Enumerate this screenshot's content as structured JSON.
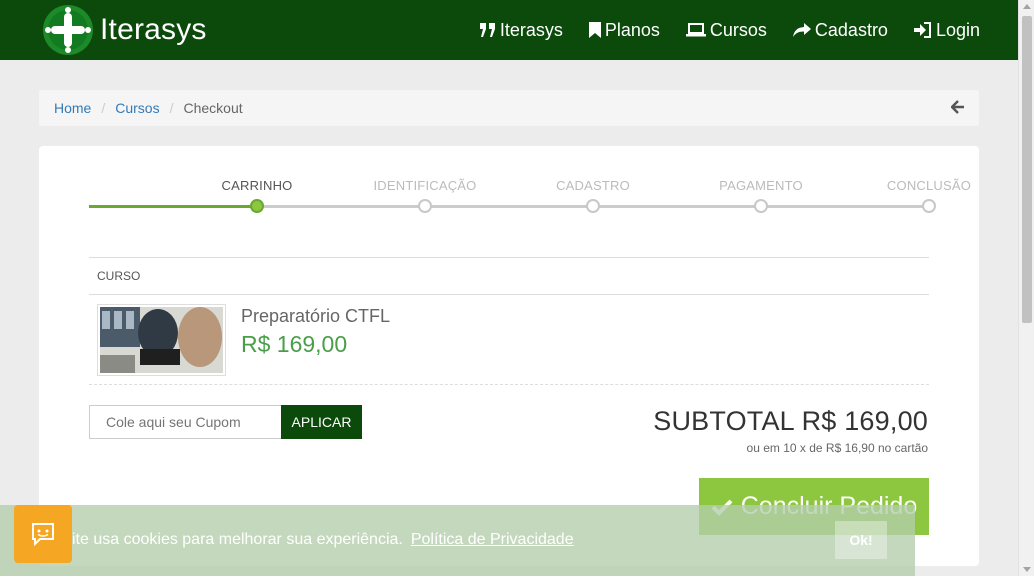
{
  "brand": {
    "name": "Iterasys"
  },
  "nav": {
    "items": [
      {
        "label": "Iterasys",
        "icon": "quote-icon"
      },
      {
        "label": "Planos",
        "icon": "bookmark-icon"
      },
      {
        "label": "Cursos",
        "icon": "laptop-icon"
      },
      {
        "label": "Cadastro",
        "icon": "share-icon"
      },
      {
        "label": "Login",
        "icon": "sign-in-icon"
      }
    ]
  },
  "breadcrumb": {
    "items": [
      "Home",
      "Cursos",
      "Checkout"
    ],
    "separator": "/"
  },
  "steps": [
    {
      "label": "CARRINHO",
      "active": true
    },
    {
      "label": "IDENTIFICAÇÃO",
      "active": false
    },
    {
      "label": "CADASTRO",
      "active": false
    },
    {
      "label": "PAGAMENTO",
      "active": false
    },
    {
      "label": "CONCLUSÃO",
      "active": false
    }
  ],
  "cart": {
    "header": "CURSO",
    "items": [
      {
        "name": "Preparatório CTFL",
        "price": "R$ 169,00"
      }
    ]
  },
  "coupon": {
    "placeholder": "Cole aqui seu Cupom",
    "button_label": "APLICAR"
  },
  "summary": {
    "subtotal": "SUBTOTAL R$ 169,00",
    "installments": "ou em 10 x de R$ 16,90 no cartão",
    "checkout_label": "Concluir Pedido"
  },
  "cookie": {
    "text": "ite usa cookies para melhorar sua experiência.",
    "link": "Política de Privacidade",
    "ok_label": "Ok!"
  },
  "colors": {
    "navbar": "#0b4a0b",
    "accent_green": "#8dc63f",
    "price_green": "#4a9e4a",
    "chat_orange": "#f5a623"
  }
}
